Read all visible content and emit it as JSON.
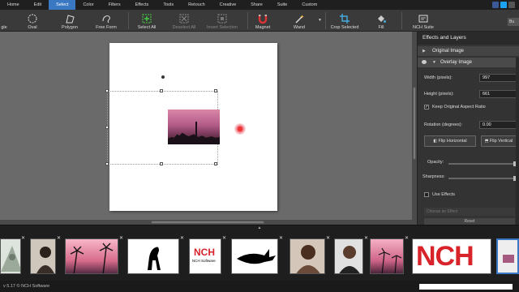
{
  "menu": [
    "Home",
    "Edit",
    "Select",
    "Color",
    "Filters",
    "Effects",
    "Tools",
    "Retouch",
    "Creative",
    "Share",
    "Suite",
    "Custom"
  ],
  "menu_active": "Select",
  "toolbar": {
    "rectangle": "gle",
    "oval": "Oval",
    "polygon": "Polygon",
    "free_form": "Free Form",
    "select_all": "Select All",
    "deselect_all": "Deselect All",
    "invert_selection": "Invert Selection",
    "magnet": "Magnet",
    "wand": "Wand",
    "crop_selected": "Crop Selected",
    "fill": "Fill",
    "nch_suite": "NCH Suite",
    "bu": "Bu"
  },
  "panel": {
    "title": "Effects and Layers",
    "original_image": "Original Image",
    "overlay_image": "Overlay Image",
    "width_label": "Width (pixels):",
    "width_value": "997",
    "height_label": "Height (pixels):",
    "height_value": "661",
    "keep_ratio": "Keep Original Aspect Ratio",
    "rotation_label": "Rotation (degrees):",
    "rotation_value": "0.00",
    "flip_h": "Flip Horizontal",
    "flip_v": "Flip Vertical",
    "opacity": "Opacity:",
    "sharpness": "Sharpness:",
    "use_effects": "Use Effects",
    "choose_effect": "Choose an Effect",
    "reset": "Reset"
  },
  "filmstrip": {
    "toggle": "▲",
    "nch_logo": "NCH",
    "nch_software": "NCH Software",
    "nch_big": "NCH"
  },
  "status": "v 5.17 © NCH Software",
  "colors": {
    "accent": "#3b78c4",
    "nch_red": "#d8232a",
    "marker": "#e33"
  }
}
